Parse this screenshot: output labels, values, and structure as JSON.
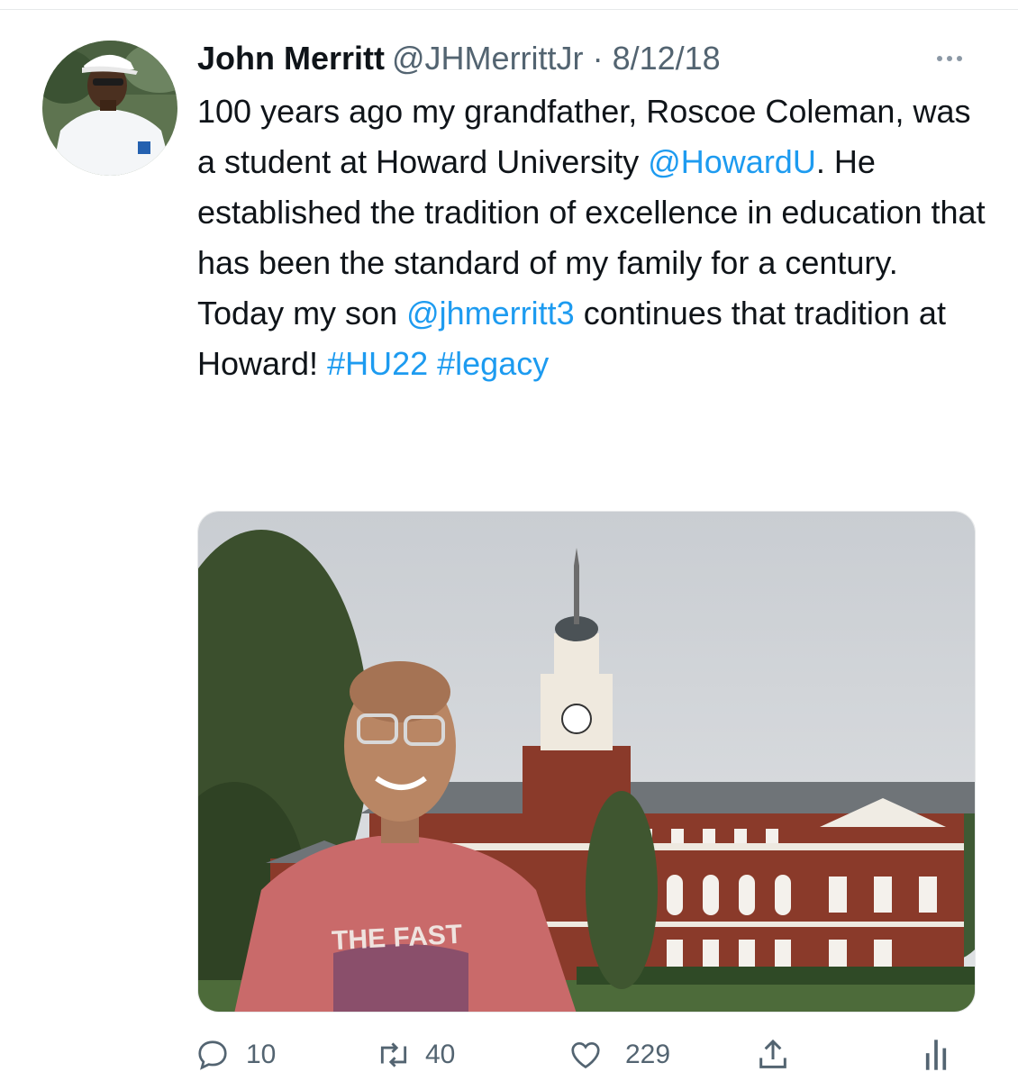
{
  "tweet": {
    "author_name": "John Merritt",
    "author_handle": "@JHMerrittJr",
    "separator": "·",
    "date": "8/12/18",
    "text_segments": [
      {
        "text": "100 years ago my grandfather, Roscoe Coleman, was a student at Howard University ",
        "type": "plain"
      },
      {
        "text": "@HowardU",
        "type": "mention"
      },
      {
        "text": ". He established the tradition of excellence in education that has been the standard of my family for a century. Today my son ",
        "type": "plain"
      },
      {
        "text": "@jhmerritt3",
        "type": "mention"
      },
      {
        "text": " continues that tradition at Howard!  ",
        "type": "plain"
      },
      {
        "text": "#HU22",
        "type": "hashtag"
      },
      {
        "text": " ",
        "type": "plain"
      },
      {
        "text": "#legacy",
        "type": "hashtag"
      }
    ],
    "media": {
      "shirt_text": "THE FAST"
    }
  },
  "actions": {
    "reply_count": "10",
    "retweet_count": "40",
    "like_count": "229"
  },
  "colors": {
    "link": "#1d9bf0",
    "text": "#0f1419",
    "secondary": "#536471",
    "divider": "#e7e9ea"
  },
  "icons": {
    "more": "more-horizontal-icon",
    "reply": "reply-icon",
    "retweet": "retweet-icon",
    "like": "heart-icon",
    "share": "share-icon",
    "analytics": "analytics-icon"
  }
}
